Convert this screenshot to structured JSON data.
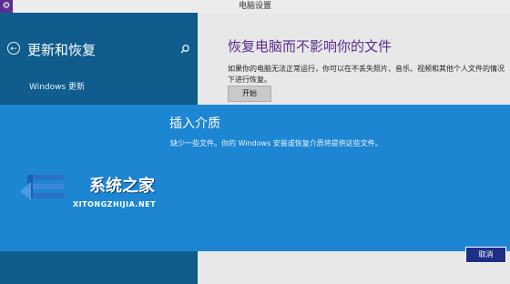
{
  "window": {
    "title": "电脑设置"
  },
  "sidebar": {
    "title": "更新和恢复",
    "items": [
      {
        "label": "Windows 更新"
      }
    ]
  },
  "main": {
    "section_title": "恢复电脑而不影响你的文件",
    "description": "如果你的电脑无法正常运行，你可以在不丢失照片、音乐、视频和其他个人文件的情况下进行恢复。",
    "start_label": "开始"
  },
  "dialog": {
    "title": "插入介质",
    "message": "缺少一些文件。你的 Windows 安装或恢复介质将提供这些文件。",
    "cancel_label": "取消"
  },
  "watermark": {
    "brand": "系统之家",
    "url": "XITONGZHIJIA.NET"
  },
  "colors": {
    "sidebar_bg": "#0f5c8d",
    "dialog_bg": "#1d86d3",
    "accent_purple": "#5b2d8e",
    "cancel_bg": "#1f2f86"
  }
}
